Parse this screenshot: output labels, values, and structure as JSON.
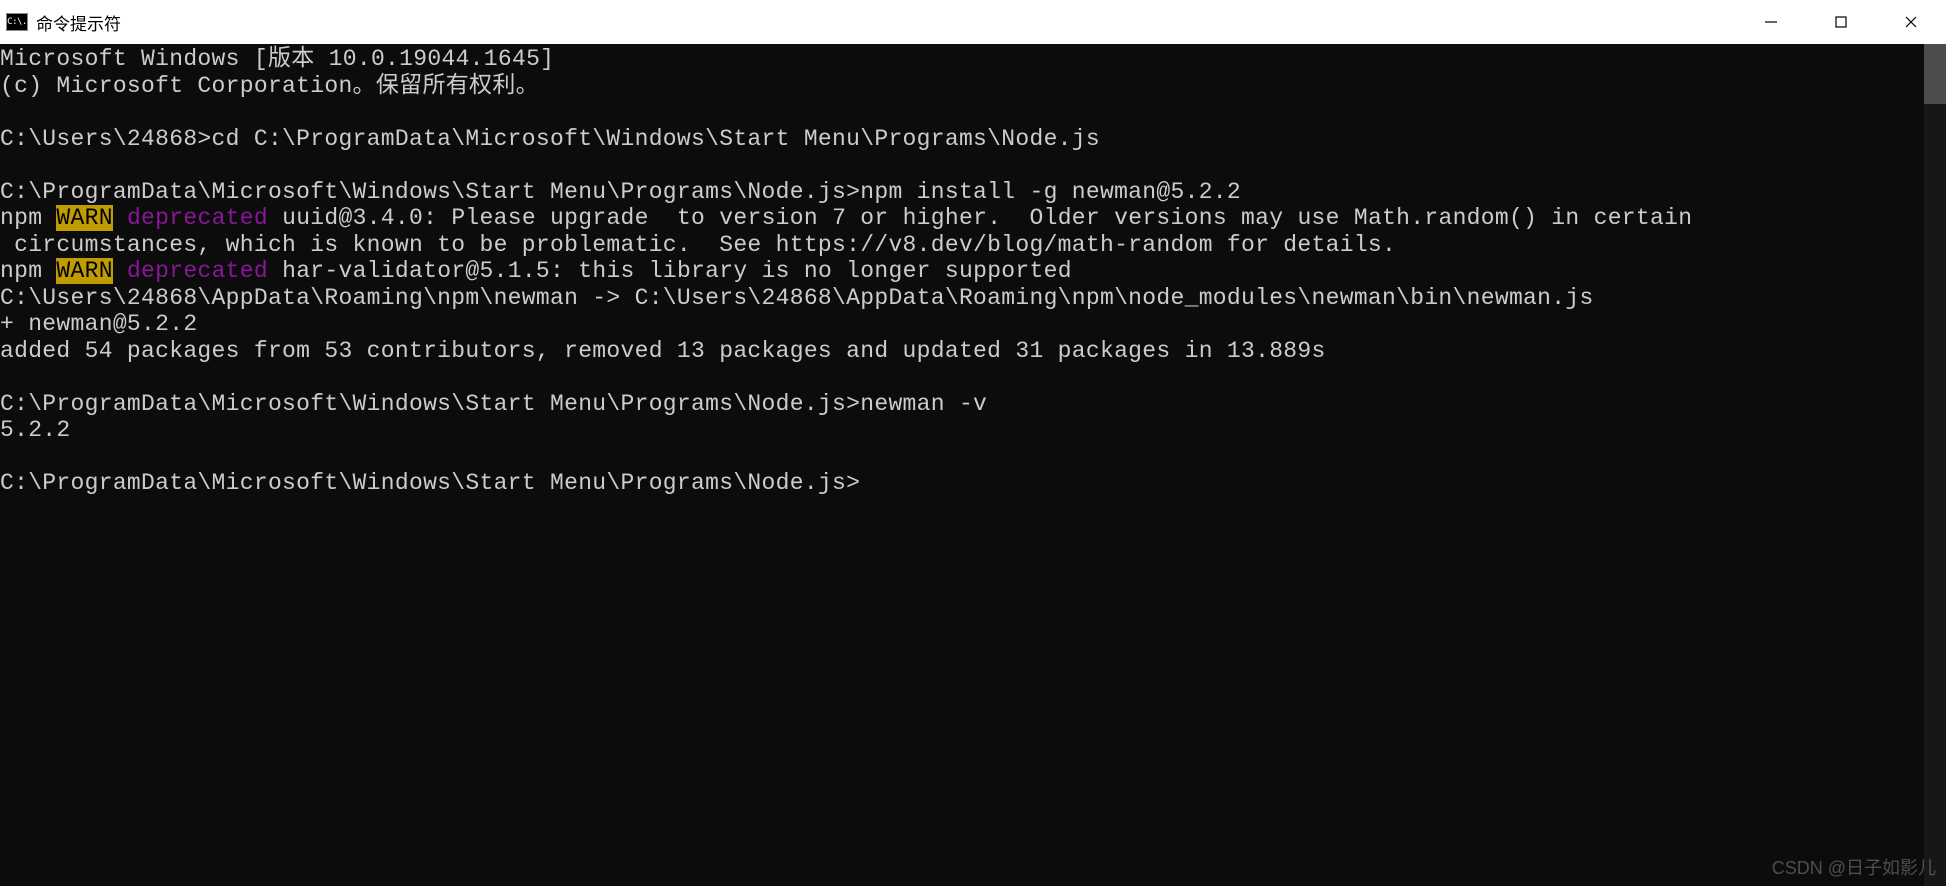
{
  "window": {
    "icon_text": "C:\\.",
    "title": "命令提示符"
  },
  "terminal": {
    "lines": [
      {
        "segments": [
          {
            "t": "Microsoft Windows [版本 10.0.19044.1645]"
          }
        ]
      },
      {
        "segments": [
          {
            "t": "(c) Microsoft Corporation。保留所有权利。"
          }
        ]
      },
      {
        "segments": [
          {
            "t": ""
          }
        ]
      },
      {
        "segments": [
          {
            "t": "C:\\Users\\24868>cd C:\\ProgramData\\Microsoft\\Windows\\Start Menu\\Programs\\Node.js"
          }
        ]
      },
      {
        "segments": [
          {
            "t": ""
          }
        ]
      },
      {
        "segments": [
          {
            "t": "C:\\ProgramData\\Microsoft\\Windows\\Start Menu\\Programs\\Node.js>npm install -g newman@5.2.2"
          }
        ]
      },
      {
        "segments": [
          {
            "t": "npm "
          },
          {
            "t": "WARN",
            "cls": "warn"
          },
          {
            "t": " "
          },
          {
            "t": "deprecated",
            "cls": "deprecated"
          },
          {
            "t": " uuid@3.4.0: Please upgrade  to version 7 or higher.  Older versions may use Math.random() in certain"
          }
        ]
      },
      {
        "segments": [
          {
            "t": " circumstances, which is known to be problematic.  See https://v8.dev/blog/math-random for details."
          }
        ]
      },
      {
        "segments": [
          {
            "t": "npm "
          },
          {
            "t": "WARN",
            "cls": "warn"
          },
          {
            "t": " "
          },
          {
            "t": "deprecated",
            "cls": "deprecated"
          },
          {
            "t": " har-validator@5.1.5: this library is no longer supported"
          }
        ]
      },
      {
        "segments": [
          {
            "t": "C:\\Users\\24868\\AppData\\Roaming\\npm\\newman -> C:\\Users\\24868\\AppData\\Roaming\\npm\\node_modules\\newman\\bin\\newman.js"
          }
        ]
      },
      {
        "segments": [
          {
            "t": "+ newman@5.2.2"
          }
        ]
      },
      {
        "segments": [
          {
            "t": "added 54 packages from 53 contributors, removed 13 packages and updated 31 packages in 13.889s"
          }
        ]
      },
      {
        "segments": [
          {
            "t": ""
          }
        ]
      },
      {
        "segments": [
          {
            "t": "C:\\ProgramData\\Microsoft\\Windows\\Start Menu\\Programs\\Node.js>newman -v"
          }
        ]
      },
      {
        "segments": [
          {
            "t": "5.2.2"
          }
        ]
      },
      {
        "segments": [
          {
            "t": ""
          }
        ]
      },
      {
        "segments": [
          {
            "t": "C:\\ProgramData\\Microsoft\\Windows\\Start Menu\\Programs\\Node.js>"
          }
        ]
      }
    ]
  },
  "watermark": "CSDN @日子如影儿"
}
